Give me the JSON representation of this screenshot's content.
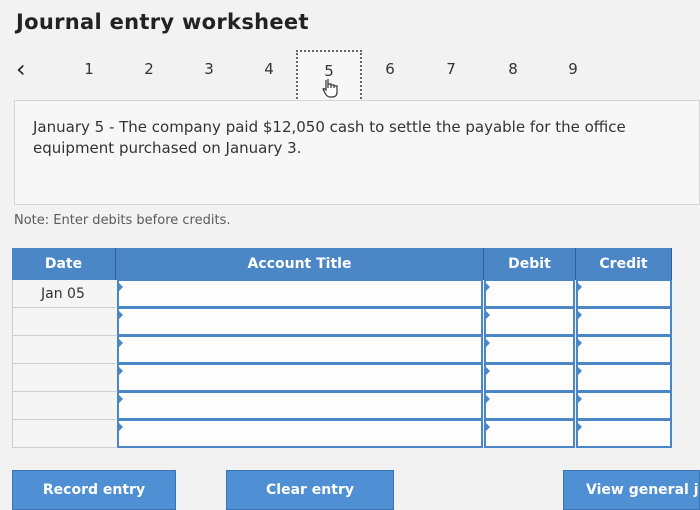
{
  "title": "Journal entry worksheet",
  "nav": {
    "prev_icon": "‹",
    "steps": [
      "1",
      "2",
      "3",
      "4",
      "5",
      "6",
      "7",
      "8",
      "9"
    ],
    "active": "5"
  },
  "question": "January 5 - The company paid $12,050 cash to settle the payable for the office equipment purchased on January 3.",
  "note": "Note: Enter debits before credits.",
  "table": {
    "headers": {
      "date": "Date",
      "account": "Account Title",
      "debit": "Debit",
      "credit": "Credit"
    },
    "rows": [
      {
        "date": "Jan 05"
      },
      {
        "date": ""
      },
      {
        "date": ""
      },
      {
        "date": ""
      },
      {
        "date": ""
      },
      {
        "date": ""
      }
    ]
  },
  "buttons": {
    "record": "Record entry",
    "clear": "Clear entry",
    "view": "View general jo"
  },
  "colors": {
    "accent": "#4b86c6"
  }
}
